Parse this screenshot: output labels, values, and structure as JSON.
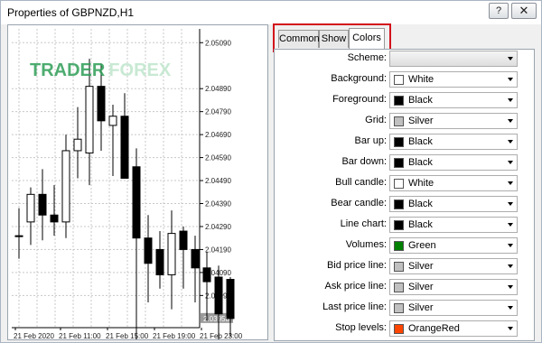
{
  "window": {
    "title": "Properties of GBPNZD,H1",
    "help_glyph": "?",
    "close_glyph": "✕"
  },
  "chart": {
    "watermark": {
      "part1": "TRADER",
      "part2": "FOREX"
    },
    "price_labels": [
      "2.05090",
      "2.04890",
      "2.04790",
      "2.04690",
      "2.04590",
      "2.04490",
      "2.04390",
      "2.04290",
      "2.04190",
      "2.04090",
      "2.03990"
    ],
    "current_price_label": "2.03958",
    "time_labels": [
      "21 Feb 2020",
      "21 Feb 11:00",
      "21 Feb 15:00",
      "21 Feb 19:00",
      "21 Feb 23:00"
    ]
  },
  "chart_data": {
    "type": "candlestick",
    "bars": [
      {
        "o": 2.0425,
        "h": 2.0437,
        "l": 2.0415,
        "c": 2.0425
      },
      {
        "o": 2.0431,
        "h": 2.0446,
        "l": 2.0421,
        "c": 2.0443
      },
      {
        "o": 2.0443,
        "h": 2.0454,
        "l": 2.0423,
        "c": 2.0434
      },
      {
        "o": 2.0434,
        "h": 2.0447,
        "l": 2.0425,
        "c": 2.0431
      },
      {
        "o": 2.0431,
        "h": 2.0469,
        "l": 2.0424,
        "c": 2.0462
      },
      {
        "o": 2.0462,
        "h": 2.0481,
        "l": 2.045,
        "c": 2.0467
      },
      {
        "o": 2.0461,
        "h": 2.0502,
        "l": 2.0447,
        "c": 2.049
      },
      {
        "o": 2.049,
        "h": 2.05,
        "l": 2.0462,
        "c": 2.0475
      },
      {
        "o": 2.0473,
        "h": 2.0482,
        "l": 2.0451,
        "c": 2.0477
      },
      {
        "o": 2.0477,
        "h": 2.0487,
        "l": 2.045,
        "c": 2.045
      },
      {
        "o": 2.0455,
        "h": 2.0463,
        "l": 2.0378,
        "c": 2.0424
      },
      {
        "o": 2.0424,
        "h": 2.0434,
        "l": 2.0396,
        "c": 2.0413
      },
      {
        "o": 2.0419,
        "h": 2.0427,
        "l": 2.0402,
        "c": 2.0408
      },
      {
        "o": 2.0408,
        "h": 2.0436,
        "l": 2.0393,
        "c": 2.0426
      },
      {
        "o": 2.0427,
        "h": 2.0429,
        "l": 2.0402,
        "c": 2.0419
      },
      {
        "o": 2.0419,
        "h": 2.0425,
        "l": 2.0396,
        "c": 2.0411
      },
      {
        "o": 2.0411,
        "h": 2.0418,
        "l": 2.0388,
        "c": 2.0405
      },
      {
        "o": 2.0407,
        "h": 2.0412,
        "l": 2.0376,
        "c": 2.0391
      },
      {
        "o": 2.0406,
        "h": 2.0407,
        "l": 2.0381,
        "c": 2.0389
      }
    ],
    "ylim": [
      2.0385,
      2.0515
    ],
    "grid": true
  },
  "tabs": [
    {
      "label": "Common",
      "active": false
    },
    {
      "label": "Show",
      "active": false
    },
    {
      "label": "Colors",
      "active": true
    }
  ],
  "colors": {
    "scheme": {
      "label": "Scheme:",
      "value": ""
    },
    "rows": [
      {
        "label": "Background:",
        "value": "White",
        "swatch": "#ffffff"
      },
      {
        "label": "Foreground:",
        "value": "Black",
        "swatch": "#000000"
      },
      {
        "label": "Grid:",
        "value": "Silver",
        "swatch": "#c0c0c0"
      },
      {
        "label": "Bar up:",
        "value": "Black",
        "swatch": "#000000"
      },
      {
        "label": "Bar down:",
        "value": "Black",
        "swatch": "#000000"
      },
      {
        "label": "Bull candle:",
        "value": "White",
        "swatch": "#ffffff"
      },
      {
        "label": "Bear candle:",
        "value": "Black",
        "swatch": "#000000"
      },
      {
        "label": "Line chart:",
        "value": "Black",
        "swatch": "#000000"
      },
      {
        "label": "Volumes:",
        "value": "Green",
        "swatch": "#008000"
      },
      {
        "label": "Bid price line:",
        "value": "Silver",
        "swatch": "#c0c0c0"
      },
      {
        "label": "Ask price line:",
        "value": "Silver",
        "swatch": "#c0c0c0"
      },
      {
        "label": "Last price line:",
        "value": "Silver",
        "swatch": "#c0c0c0"
      },
      {
        "label": "Stop levels:",
        "value": "OrangeRed",
        "swatch": "#ff4500"
      }
    ]
  }
}
